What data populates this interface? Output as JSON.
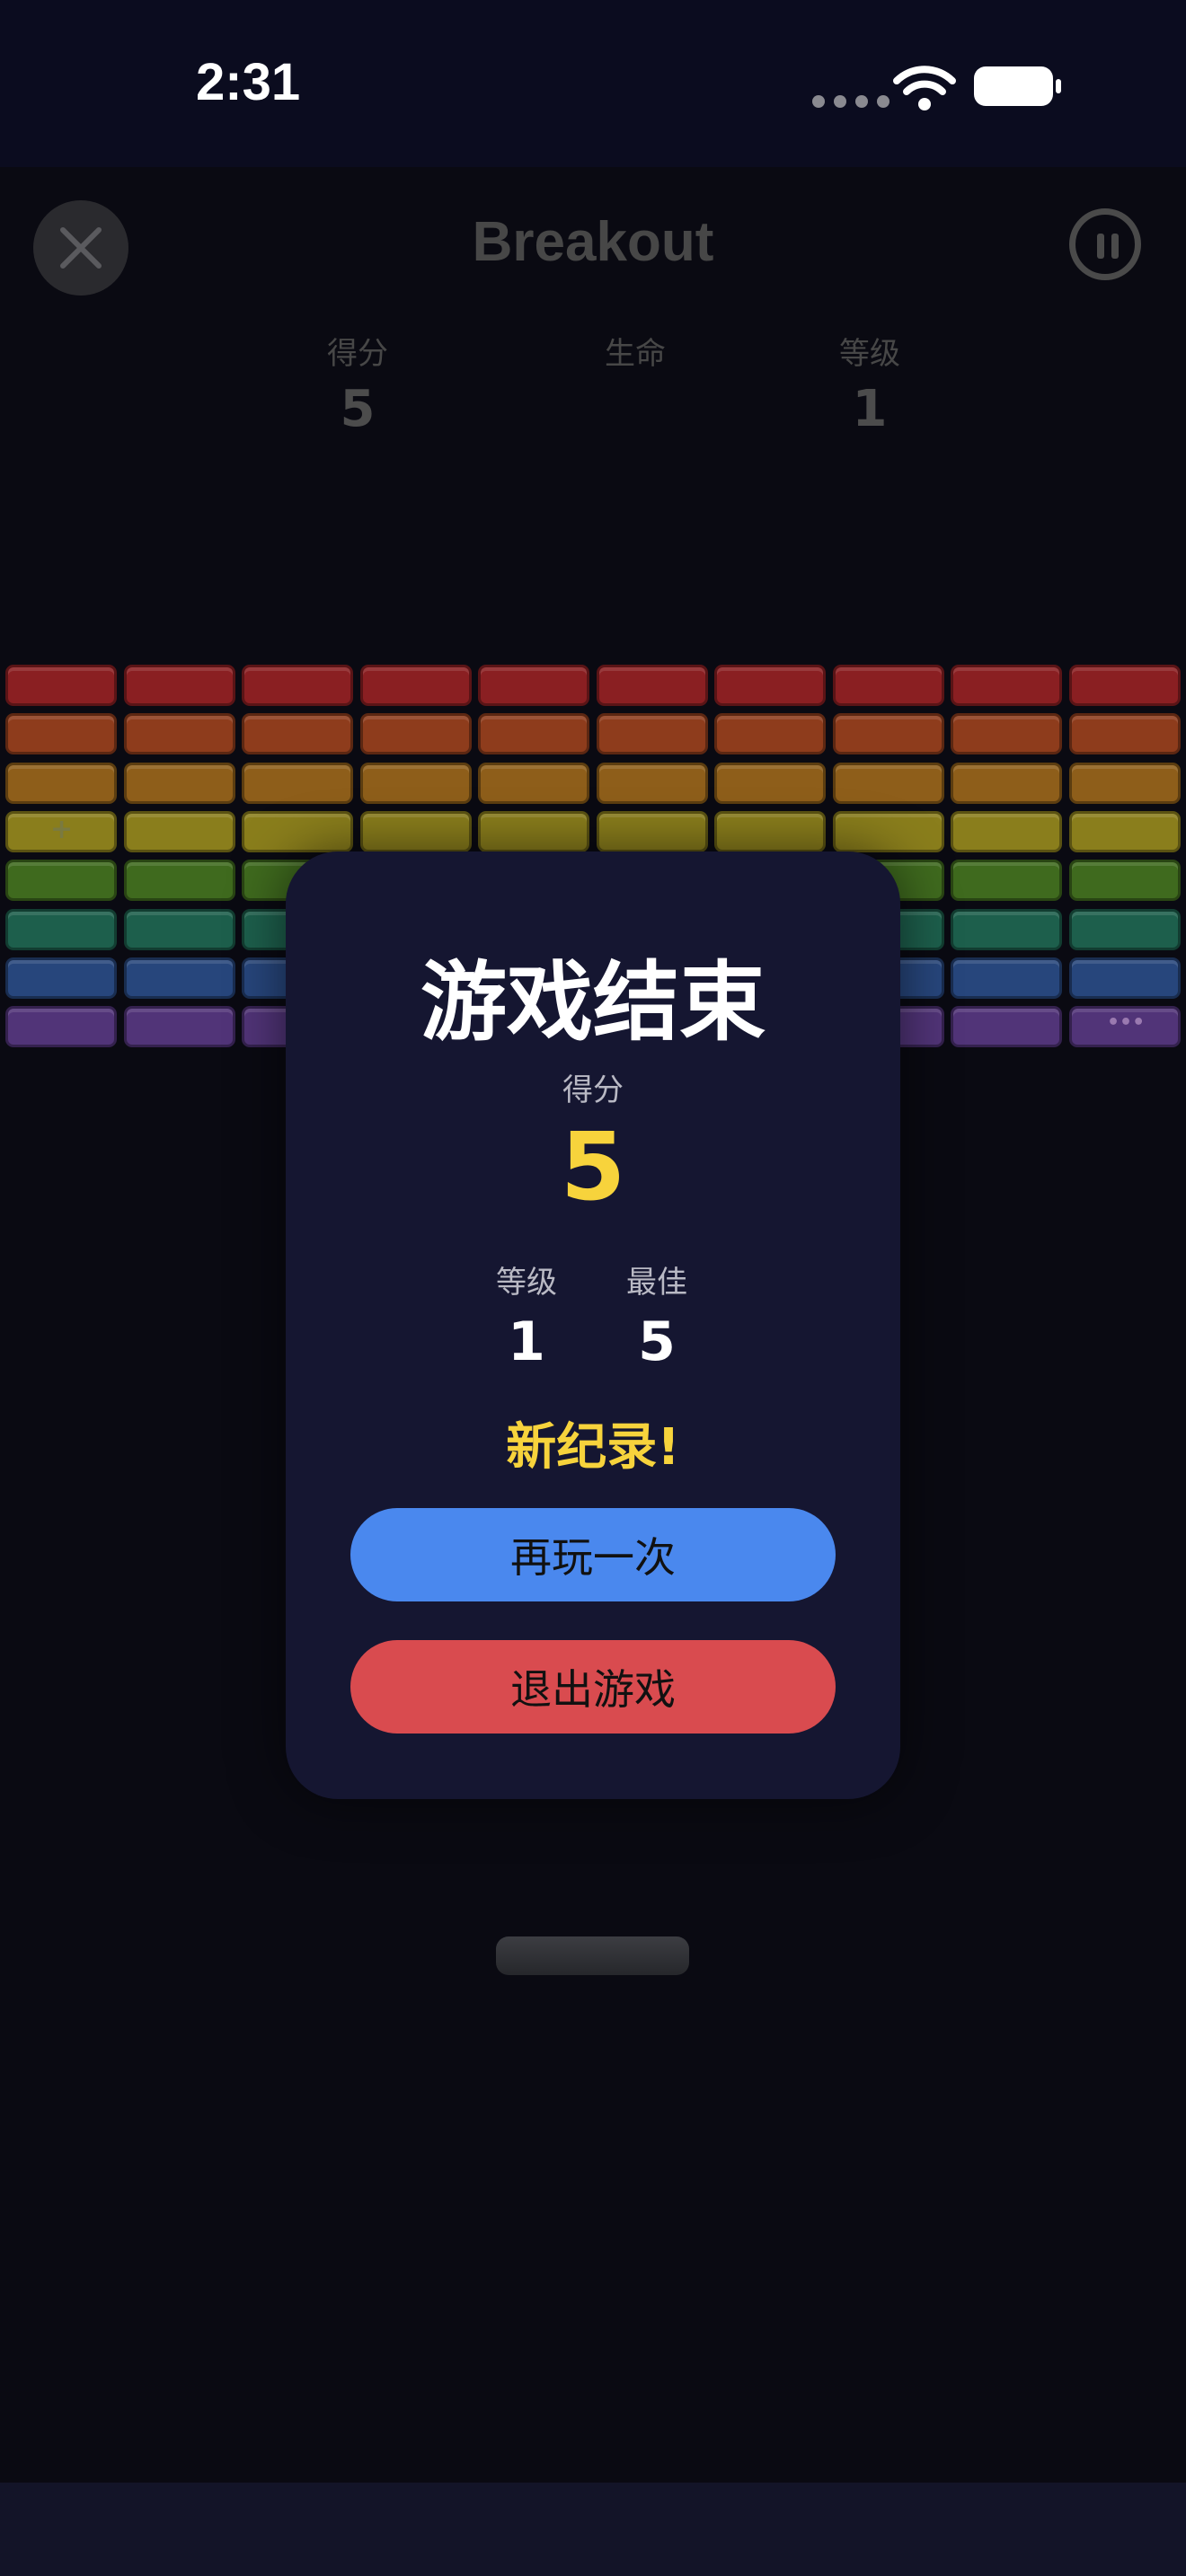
{
  "status_bar": {
    "time": "2:31"
  },
  "game": {
    "title": "Breakout",
    "stats": [
      {
        "label": "得分",
        "value": "5"
      },
      {
        "label": "生命",
        "value": ""
      },
      {
        "label": "等级",
        "value": "1"
      }
    ],
    "brick_colors": [
      "#8a1f22",
      "#8e3c1c",
      "#8e5e1a",
      "#8a7e1c",
      "#3f6a1e",
      "#1d5f4c",
      "#27467c",
      "#513478"
    ],
    "brick_glyphs": {
      "plus": "+",
      "dots": "•••"
    }
  },
  "game_over": {
    "title": "游戏结束",
    "score_label": "得分",
    "score": "5",
    "level_label": "等级",
    "level": "1",
    "best_label": "最佳",
    "best": "5",
    "record_text": "新纪录!",
    "replay_label": "再玩一次",
    "quit_label": "退出游戏"
  }
}
